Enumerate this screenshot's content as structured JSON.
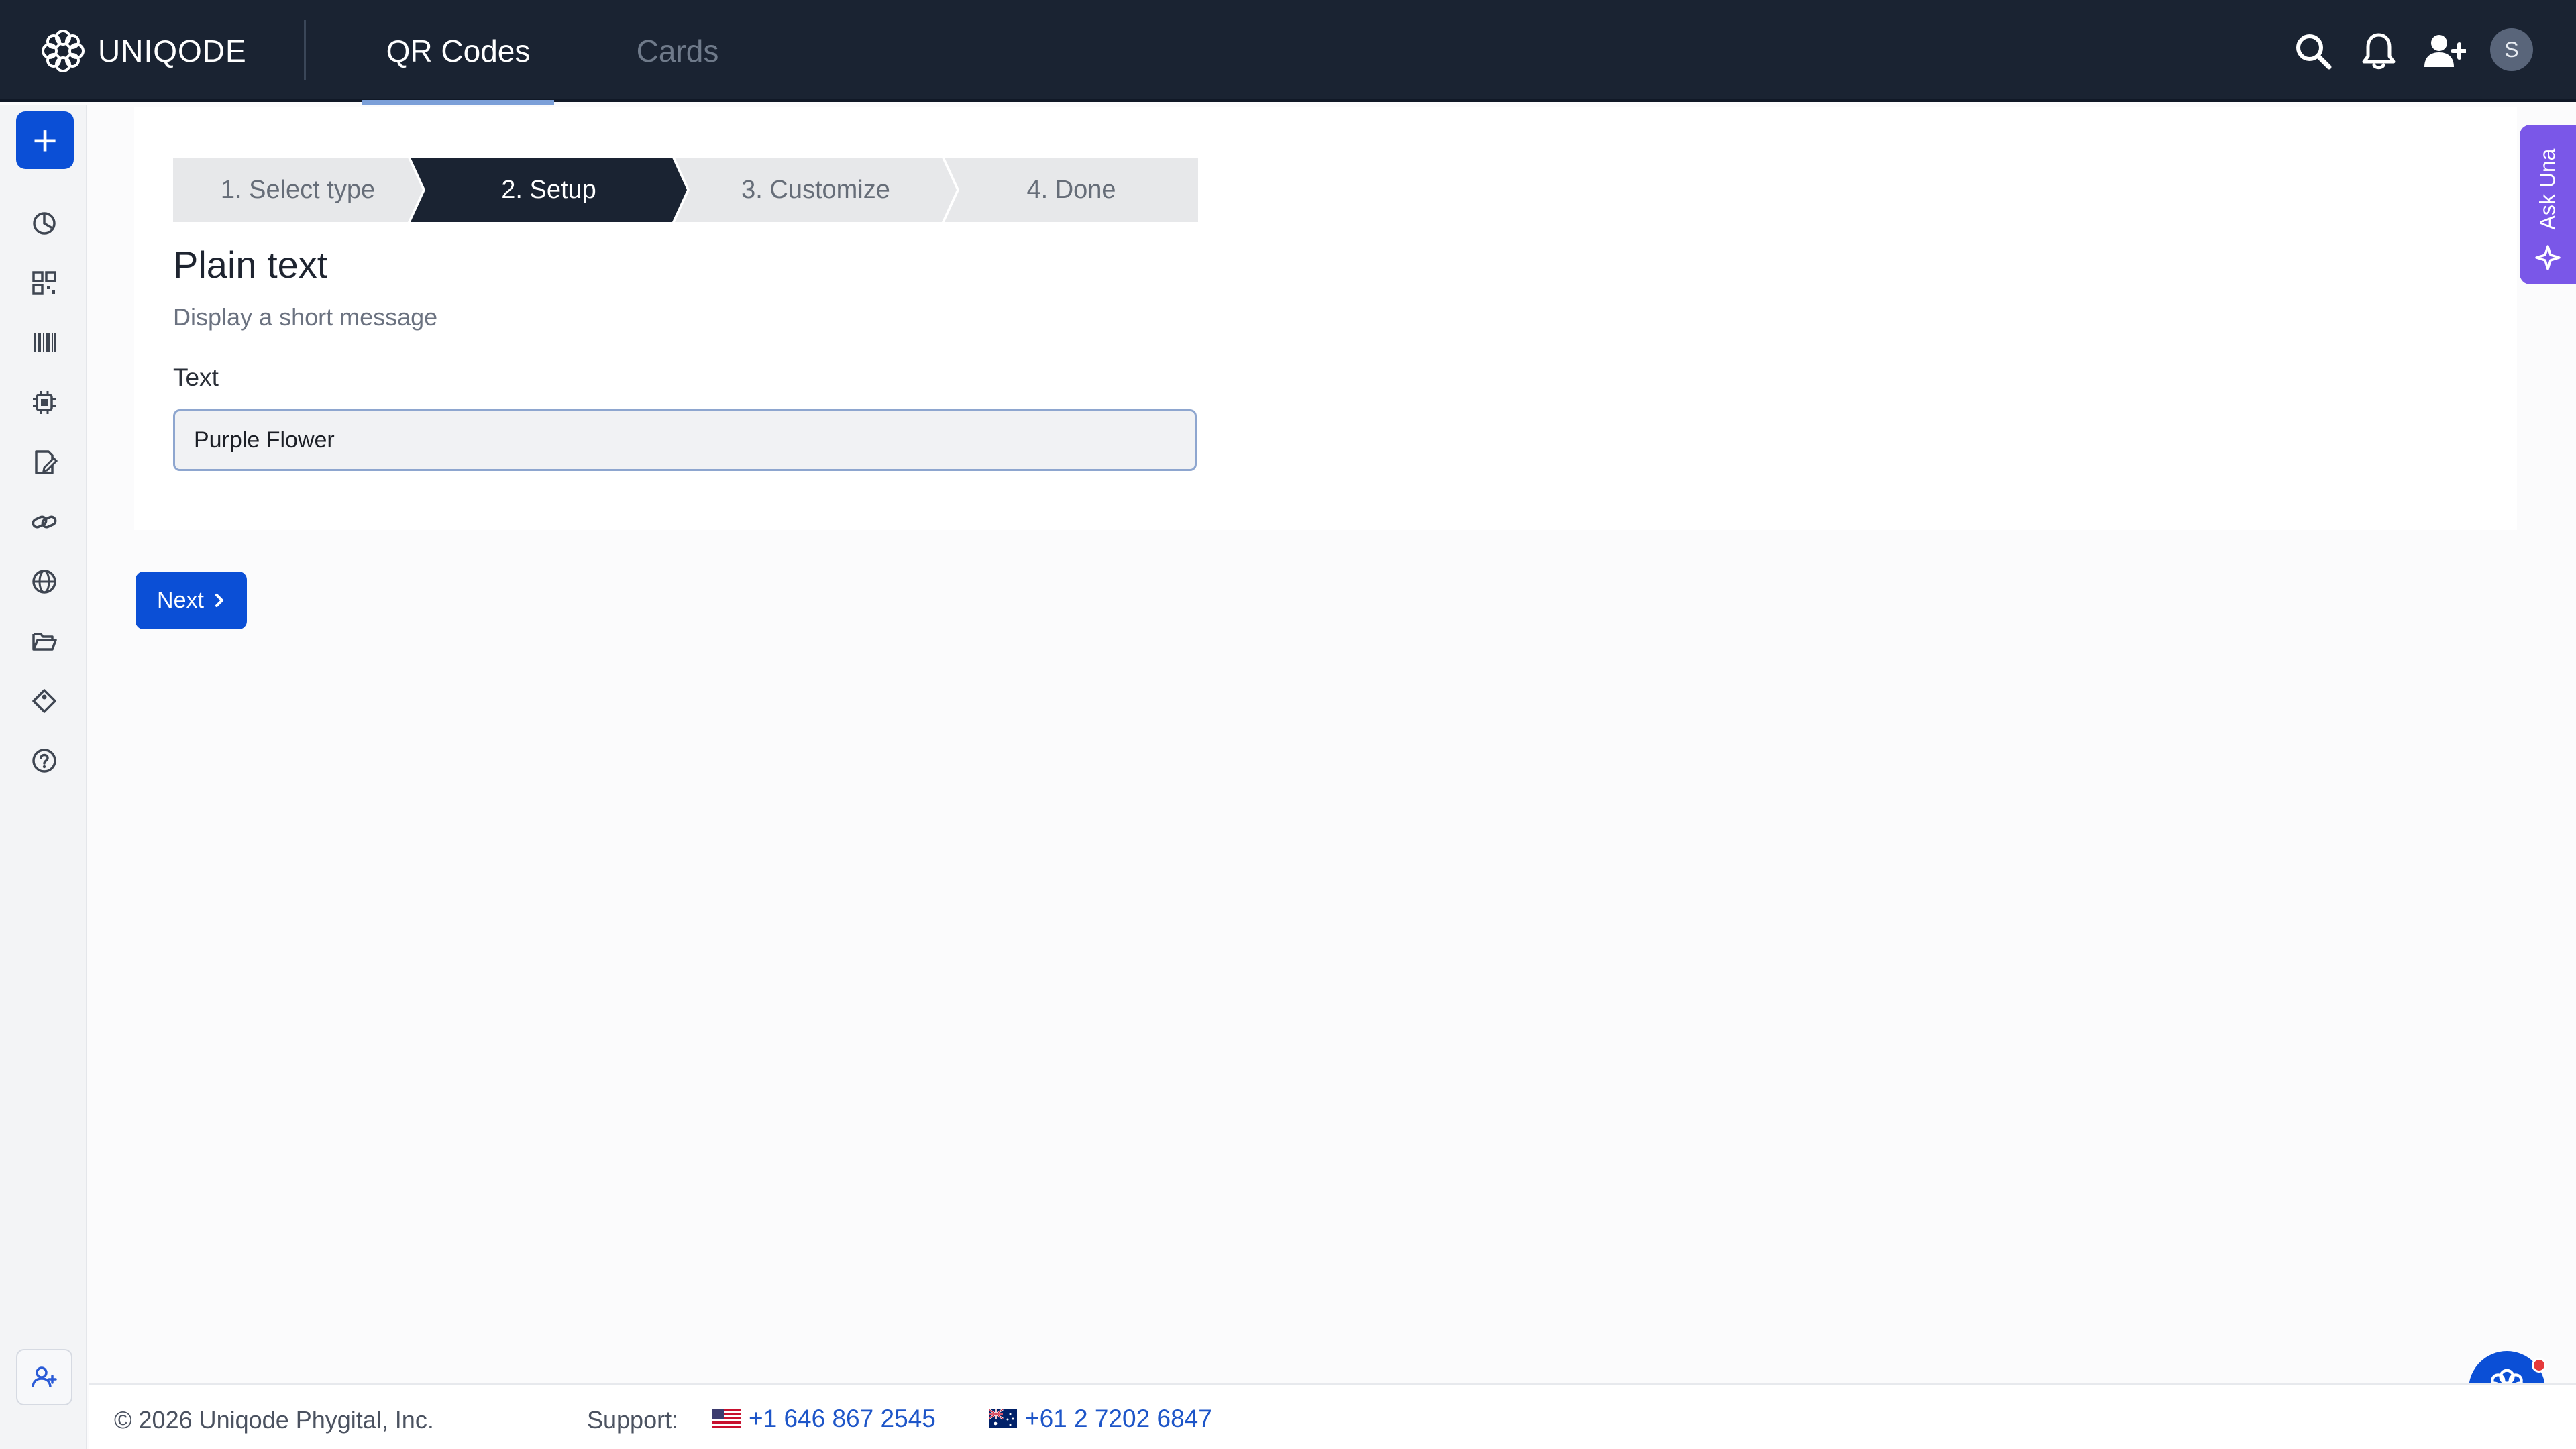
{
  "header": {
    "brand": "UNIQODE",
    "tabs": [
      {
        "label": "QR Codes",
        "active": true
      },
      {
        "label": "Cards",
        "active": false
      }
    ],
    "icons": [
      "search-icon",
      "bell-icon",
      "add-user-icon"
    ],
    "avatar_initial": "S"
  },
  "sidebar": {
    "create_label": "+",
    "items": [
      "dashboard-icon",
      "qr-code-icon",
      "barcode-icon",
      "chip-icon",
      "form-icon",
      "link-icon",
      "globe-icon",
      "folder-icon",
      "tag-icon",
      "help-icon"
    ],
    "bottom_icon": "team-icon"
  },
  "stepper": {
    "steps": [
      {
        "label": "1. Select type",
        "state": "done"
      },
      {
        "label": "2. Setup",
        "state": "current"
      },
      {
        "label": "3. Customize",
        "state": "todo"
      },
      {
        "label": "4. Done",
        "state": "todo"
      }
    ]
  },
  "form": {
    "title": "Plain text",
    "subtitle": "Display a short message",
    "text_label": "Text",
    "text_value": "Purple Flower"
  },
  "actions": {
    "next_label": "Next"
  },
  "ask_una": {
    "label": "Ask Una"
  },
  "footer": {
    "copyright": "© 2026 Uniqode Phygital, Inc.",
    "support_label": "Support:",
    "phones": [
      {
        "flag": "us-flag-icon",
        "number": "+1 646 867 2545"
      },
      {
        "flag": "au-flag-icon",
        "number": "+61 2 7202 6847"
      }
    ]
  },
  "colors": {
    "topbar": "#1a2332",
    "primary": "#0b4fd6",
    "ask_una": "#7a57e8",
    "link": "#1d55c8"
  }
}
